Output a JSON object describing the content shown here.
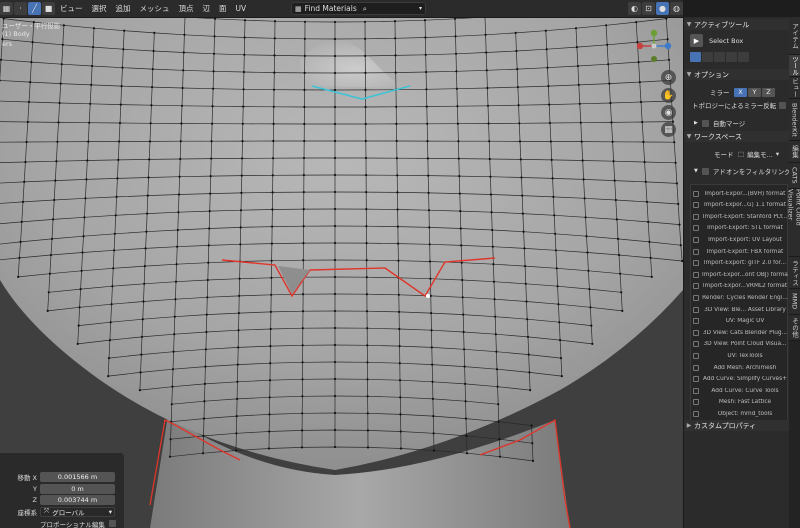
{
  "header": {
    "menus": [
      "ビュー",
      "選択",
      "追加",
      "メッシュ",
      "頂点",
      "辺",
      "面",
      "UV"
    ],
    "find_materials": "Find Materials"
  },
  "viewport": {
    "overlay_line1": "ユーザー・平行投影",
    "overlay_line2": "(1) Body",
    "overlay_line3": "ers"
  },
  "operator_panel": {
    "move_x_label": "移動 X",
    "move_x": "0.001566 m",
    "move_y_label": "Y",
    "move_y": "0 m",
    "move_z_label": "Z",
    "move_z": "0.003744 m",
    "coord_label": "座標系",
    "coord_value": "グローバル",
    "proportional_label": "プロポーショナル編集"
  },
  "sidebar": {
    "active_tool_header": "アクティブツール",
    "select_box": "Select Box",
    "options_header": "オプション",
    "mirror_label": "ミラー",
    "axes": [
      "X",
      "Y",
      "Z"
    ],
    "topology_mirror": "トポロジーによるミラー反転",
    "auto_merge": "自動マージ",
    "workspace_header": "ワークスペース",
    "mode_label": "モード",
    "mode_value": "編集モ...",
    "filter_addons": "アドオンをフィルタリング",
    "addons": [
      "Import-Expor...(BVH) format",
      "Import-Expor...G) 1.1 format",
      "Import-Export: Stanford PLY...",
      "Import-Export: STL format",
      "Import-Export: UV Layout",
      "Import-Export: FBX format",
      "Import-Export: glTF 2.0 for...",
      "Import-Expor...ont OBJ) format",
      "Import-Expor...VRML2 format",
      "Render: Cycles Render Engi...",
      "3D View: Ble... Asset Library",
      "UV: Magic UV",
      "3D View: Cats Blender Plug...",
      "3D View: Point Cloud Visua...",
      "UV: TexTools",
      "Add Mesh: Archimesh",
      "Add Curve: Simplify Curves+",
      "Add Curve: Curve Tools",
      "Mesh: Fast Lattice",
      "Object: mmd_tools"
    ],
    "custom_props": "カスタムプロパティ"
  },
  "tabs": [
    "アイテム",
    "ツール",
    "ビュー",
    "BlenderKit",
    "編集",
    "CATS",
    "Point Cloud Visualizer",
    "ラティス",
    "MMD",
    "その他"
  ],
  "colors": {
    "accent": "#4772b3",
    "seam": "#e0352b",
    "selected_edge": "#3ec3d6"
  }
}
